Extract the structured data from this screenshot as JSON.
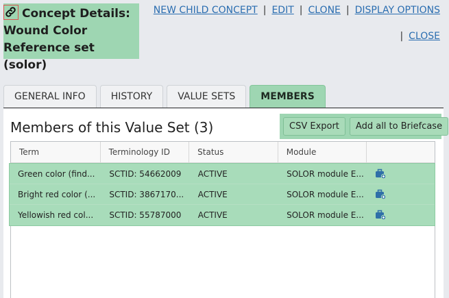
{
  "header": {
    "title": "Concept Details: Wound Color Reference set (solor)",
    "links": [
      "NEW CHILD CONCEPT",
      "EDIT",
      "CLONE",
      "DISPLAY OPTIONS"
    ],
    "close_label": "CLOSE"
  },
  "tabs": [
    {
      "label": "GENERAL INFO",
      "active": false
    },
    {
      "label": "HISTORY",
      "active": false
    },
    {
      "label": "VALUE SETS",
      "active": false
    },
    {
      "label": "MEMBERS",
      "active": true
    }
  ],
  "members": {
    "title": "Members of this Value Set (3)",
    "csv_label": "CSV Export",
    "add_all_label": "Add all to Briefcase",
    "columns": [
      "Term",
      "Terminology ID",
      "Status",
      "Module",
      ""
    ],
    "rows": [
      {
        "term": "Green color (find...",
        "id": "SCTID: 54662009",
        "status": "ACTIVE",
        "module": "SOLOR module E..."
      },
      {
        "term": "Bright red color (...",
        "id": "SCTID: 3867170...",
        "status": "ACTIVE",
        "module": "SOLOR module E..."
      },
      {
        "term": "Yellowish red col...",
        "id": "SCTID: 55787000",
        "status": "ACTIVE",
        "module": "SOLOR module E..."
      }
    ]
  },
  "colors": {
    "accent_green": "#9ed6b2",
    "link_blue": "#2a6db0"
  },
  "icons": {
    "title": "link-icon",
    "row_action": "briefcase-add-icon"
  }
}
